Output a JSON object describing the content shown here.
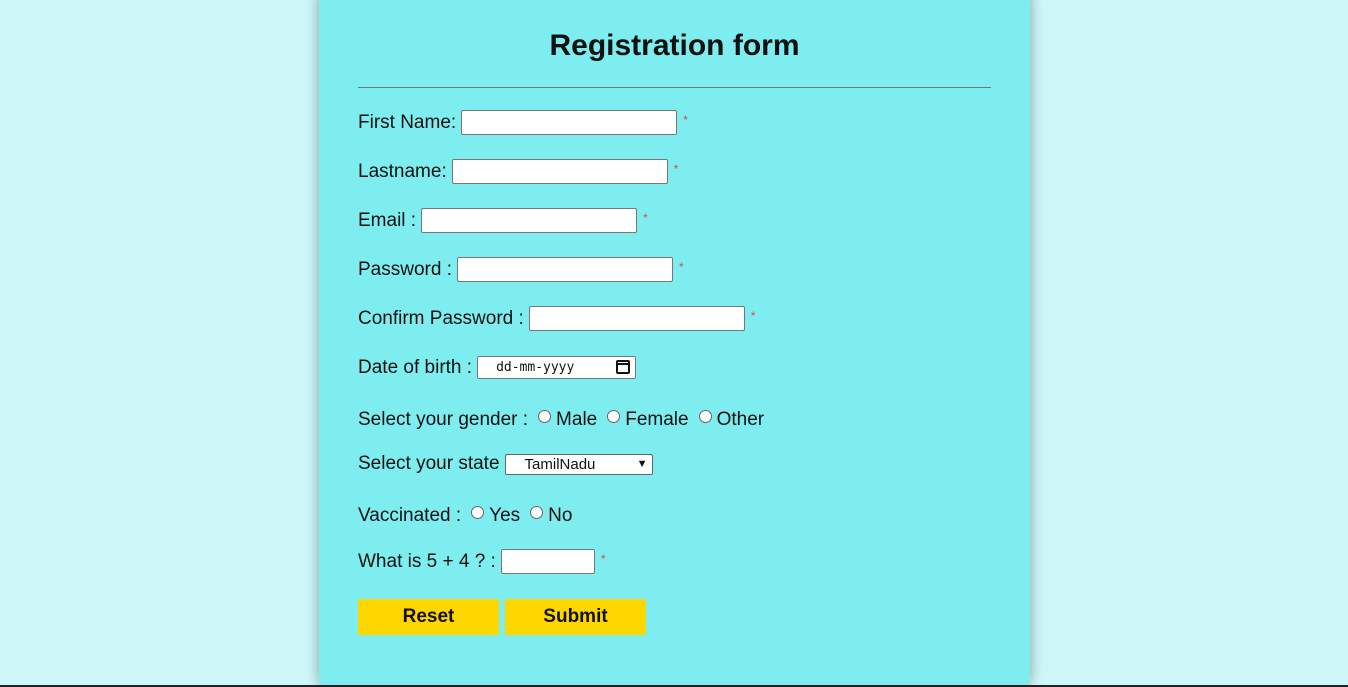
{
  "form": {
    "title": "Registration form",
    "required_marker": "*",
    "fields": {
      "first_name": {
        "label": "First Name:",
        "value": ""
      },
      "last_name": {
        "label": "Lastname:",
        "value": ""
      },
      "email": {
        "label": "Email :",
        "value": ""
      },
      "password": {
        "label": "Password :",
        "value": ""
      },
      "confirm_password": {
        "label": "Confirm Password :",
        "value": ""
      },
      "dob": {
        "label": "Date of birth :",
        "placeholder": "dd-mm-yyyy"
      },
      "gender": {
        "label": "Select your gender :",
        "options": [
          "Male",
          "Female",
          "Other"
        ]
      },
      "state": {
        "label": "Select your state",
        "selected": "TamilNadu"
      },
      "vaccinated": {
        "label": "Vaccinated :",
        "options": [
          "Yes",
          "No"
        ]
      },
      "captcha": {
        "label": "What is 5 + 4 ? :",
        "value": ""
      }
    },
    "buttons": {
      "reset": "Reset",
      "submit": "Submit"
    }
  },
  "colors": {
    "page_bg": "#cdf7f9",
    "card_bg": "#7eedf0",
    "button_bg": "#ffd700",
    "required": "#e04a4a"
  },
  "icons": {
    "calendar": "calendar-icon",
    "dropdown": "chevron-down-icon"
  }
}
